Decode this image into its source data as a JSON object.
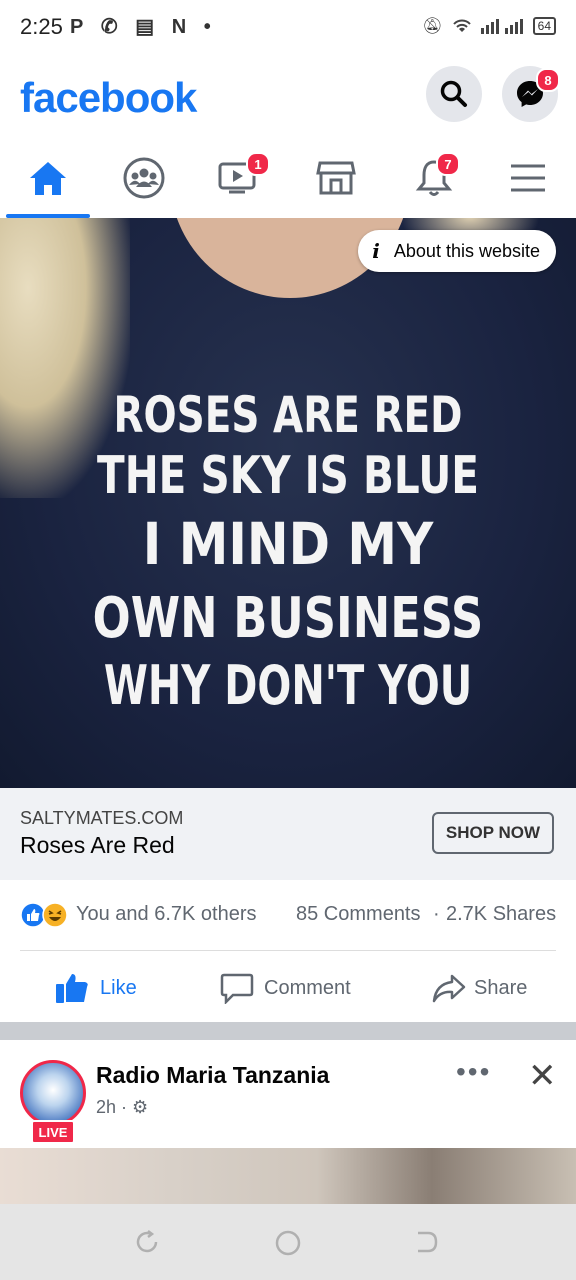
{
  "status_bar": {
    "time": "2:25",
    "battery": "64"
  },
  "header": {
    "logo": "facebook",
    "messenger_badge": "8"
  },
  "tabs": {
    "watch_badge": "1",
    "notifications_badge": "7"
  },
  "ad": {
    "about_label": "About this website",
    "shirt_lines": [
      "ROSES ARE RED",
      "THE SKY IS BLUE",
      "I MIND MY",
      "OWN BUSINESS",
      "WHY DON'T YOU"
    ],
    "domain": "SALTYMATES.COM",
    "title": "Roses Are Red",
    "cta": "SHOP NOW",
    "reactions_text": "You and 6.7K others",
    "comments": "85 Comments",
    "shares": "2.7K Shares",
    "actions": {
      "like": "Like",
      "comment": "Comment",
      "share": "Share"
    }
  },
  "next_post": {
    "page_name": "Radio Maria Tanzania",
    "time": "2h",
    "live_label": "LIVE"
  },
  "colors": {
    "brand": "#1877f2",
    "badge": "#f02849"
  }
}
